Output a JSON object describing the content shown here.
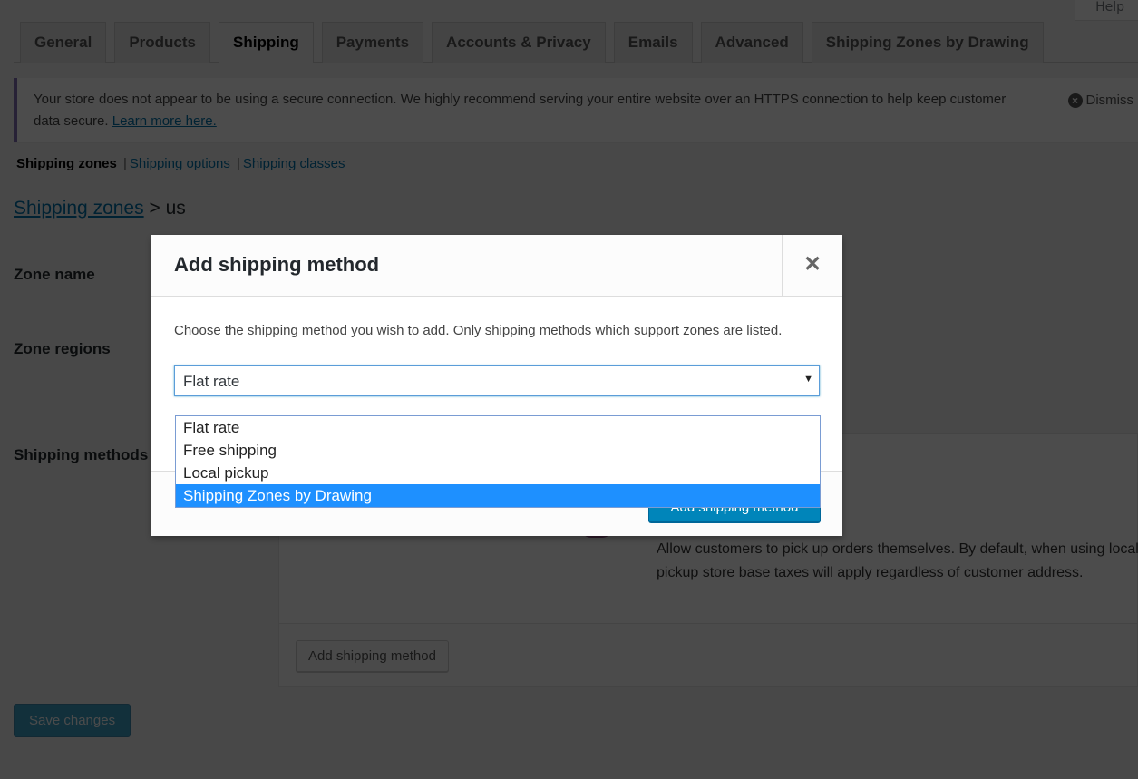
{
  "help_tab": {
    "label": "Help"
  },
  "tabs": [
    {
      "label": "General",
      "active": false
    },
    {
      "label": "Products",
      "active": false
    },
    {
      "label": "Shipping",
      "active": true
    },
    {
      "label": "Payments",
      "active": false
    },
    {
      "label": "Accounts & Privacy",
      "active": false
    },
    {
      "label": "Emails",
      "active": false
    },
    {
      "label": "Advanced",
      "active": false
    },
    {
      "label": "Shipping Zones by Drawing",
      "active": false
    }
  ],
  "notice": {
    "text": "Your store does not appear to be using a secure connection. We highly recommend serving your entire website over an HTTPS connection to help keep customer data secure.",
    "link_label": "Learn more here.",
    "dismiss_label": "Dismiss"
  },
  "subnav": {
    "current": "Shipping zones",
    "links": [
      "Shipping options",
      "Shipping classes"
    ],
    "separator": "|"
  },
  "breadcrumb": {
    "link_label": "Shipping zones",
    "separator": ">",
    "current": "us"
  },
  "form_labels": {
    "zone_name": "Zone name",
    "zone_regions": "Zone regions",
    "shipping_methods": "Shipping methods"
  },
  "methods_table": {
    "local_pickup_description": "Allow customers to pick up orders themselves. By default, when using local pickup store base taxes will apply regardless of customer address.",
    "add_button_label": "Add shipping method"
  },
  "save_button_label": "Save changes",
  "modal": {
    "title": "Add shipping method",
    "close_symbol": "✕",
    "description": "Choose the shipping method you wish to add. Only shipping methods which support zones are listed.",
    "select": {
      "selected_value": "Flat rate",
      "arrow": "▼",
      "options": [
        "Flat rate",
        "Free shipping",
        "Local pickup",
        "Shipping Zones by Drawing"
      ],
      "highlighted_option": "Shipping Zones by Drawing"
    },
    "submit_label": "Add shipping method"
  },
  "colors": {
    "accent_link": "#0073aa",
    "primary_button": "#0085ba",
    "dropdown_highlight": "#1e90ff",
    "notice_border": "#826eb4",
    "overlay": "rgba(0,0,0,0.7)"
  }
}
